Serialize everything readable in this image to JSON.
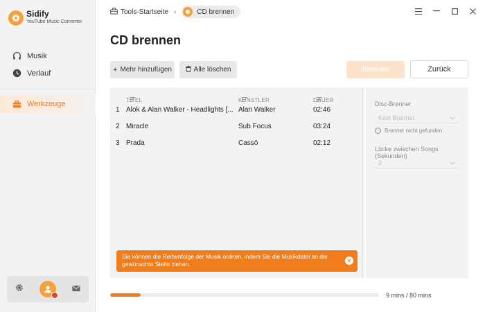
{
  "app": {
    "name": "Sidify",
    "subtitle": "YouTube Music Converter",
    "accent_color": "#f07d1c"
  },
  "sidebar": {
    "items": [
      {
        "label": "Musik",
        "icon": "headphones-icon"
      },
      {
        "label": "Verlauf",
        "icon": "clock-icon"
      },
      {
        "label": "Werkzeuge",
        "icon": "toolbox-icon",
        "active": true
      }
    ],
    "bottom": {
      "settings_icon": "gear-icon",
      "profile_icon": "avatar",
      "mail_icon": "mail-icon"
    }
  },
  "breadcrumb": {
    "home": "Tools-Startseite",
    "current": "CD brennen"
  },
  "page": {
    "title": "CD brennen"
  },
  "toolbar": {
    "add_label": "Mehr hinzufügen",
    "clear_label": "Alle löschen",
    "burn_label": "Brennen",
    "back_label": "Zurück"
  },
  "table": {
    "columns": [
      "TITEL",
      "KÜNSTLER",
      "DAUER"
    ],
    "rows": [
      {
        "n": "1",
        "title": "Alok & Alan Walker - Headlights [...",
        "artist": "Alan Walker",
        "duration": "02:46"
      },
      {
        "n": "2",
        "title": "Miracle",
        "artist": "Sub Focus",
        "duration": "03:24"
      },
      {
        "n": "3",
        "title": "Prada",
        "artist": "Cassö",
        "duration": "02:12"
      }
    ]
  },
  "toast": {
    "message": "Sie können die Reihenfolge der Musik ordnen, indem Sie die Musikdatei an die gewünschte Stelle ziehen."
  },
  "settings": {
    "burner_label": "Disc-Brenner",
    "burner_value": "Kein Brenner",
    "burner_note": "Brenner nicht gefunden.",
    "gap_label": "Lücke zwischen Songs (Sekunden)",
    "gap_value": "2"
  },
  "progress": {
    "fraction": 0.1125,
    "text": "9 mins / 80 mins"
  }
}
